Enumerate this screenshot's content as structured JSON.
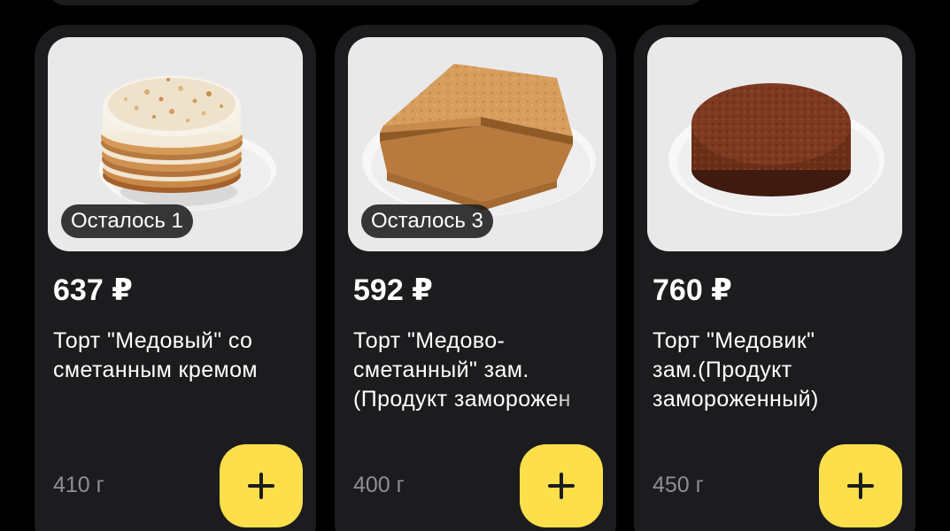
{
  "products": [
    {
      "badge": "Осталось 1",
      "price": "637 ₽",
      "name_lines": [
        "Торт \"Медовый\" со",
        "сметанным кремом"
      ],
      "weight": "410 г"
    },
    {
      "badge": "Осталось 3",
      "price": "592 ₽",
      "name_lines": [
        "Торт \"Медово-",
        "сметанный\" зам.",
        "(Продукт заморожен"
      ],
      "weight": "400 г"
    },
    {
      "price": "760 ₽",
      "name_lines": [
        "Торт \"Медовик\"",
        "зам.(Продукт",
        "замороженный)"
      ],
      "weight": "450 г"
    }
  ],
  "icons": {
    "add": "plus-icon"
  },
  "colors": {
    "background": "#000000",
    "card": "#1c1c1e",
    "accent": "#fcdf4b",
    "muted_text": "#8e8e93"
  }
}
